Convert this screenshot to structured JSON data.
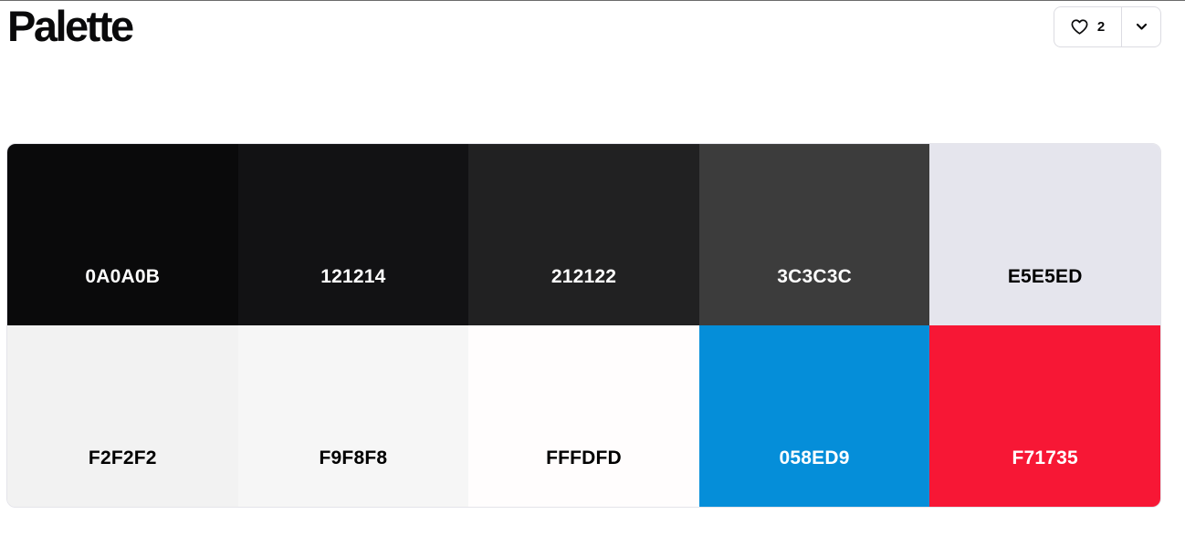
{
  "page": {
    "title": "Palette"
  },
  "actions": {
    "like_icon": "heart-outline-icon",
    "like_count": "2",
    "more_icon": "chevron-down-icon"
  },
  "palette": {
    "swatches": [
      {
        "hex": "0A0A0B",
        "color": "#0A0A0B",
        "text_color": "#ffffff"
      },
      {
        "hex": "121214",
        "color": "#121214",
        "text_color": "#ffffff"
      },
      {
        "hex": "212122",
        "color": "#212122",
        "text_color": "#ffffff"
      },
      {
        "hex": "3C3C3C",
        "color": "#3C3C3C",
        "text_color": "#ffffff"
      },
      {
        "hex": "E5E5ED",
        "color": "#E5E5ED",
        "text_color": "#000000"
      },
      {
        "hex": "F2F2F2",
        "color": "#F2F2F2",
        "text_color": "#000000"
      },
      {
        "hex": "F9F8F8",
        "color": "#F6F6F6",
        "text_color": "#000000"
      },
      {
        "hex": "FFFDFD",
        "color": "#FFFDFD",
        "text_color": "#000000"
      },
      {
        "hex": "058ED9",
        "color": "#058ED9",
        "text_color": "#ffffff"
      },
      {
        "hex": "F71735",
        "color": "#F71735",
        "text_color": "#ffffff"
      }
    ]
  }
}
